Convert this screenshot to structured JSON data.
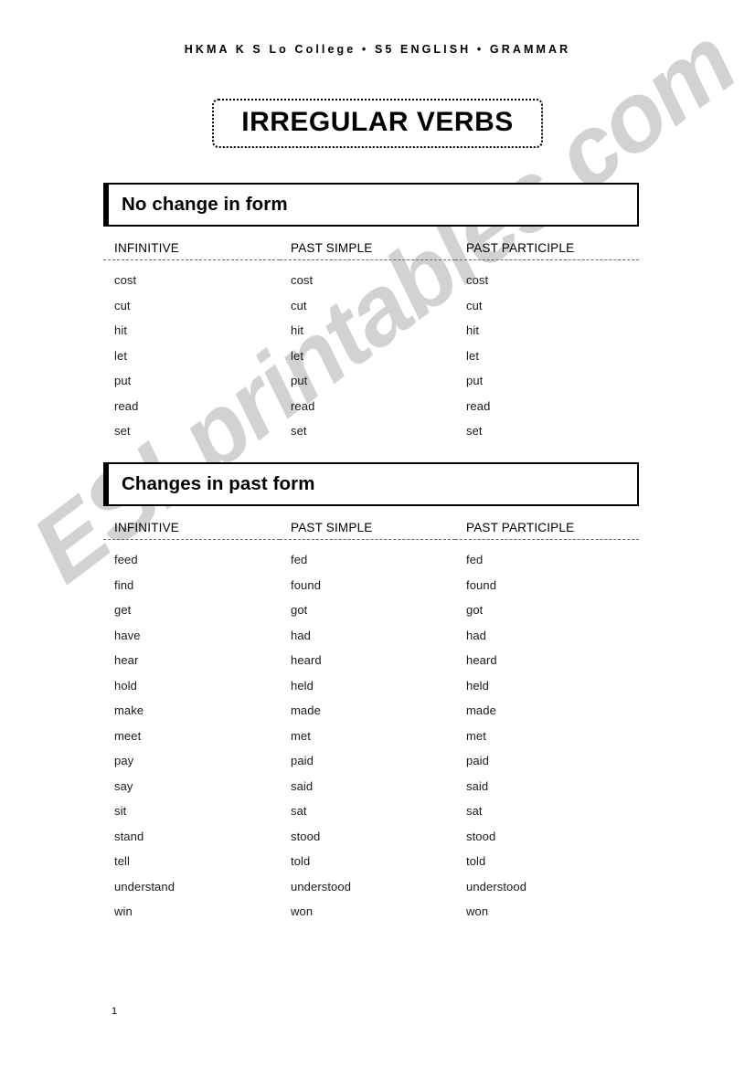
{
  "document": {
    "header": "HKMA  K  S  Lo  College   •   S5  ENGLISH   •   GRAMMAR",
    "title": "IRREGULAR VERBS",
    "page_number": "1",
    "watermark": "ESLprintables.com",
    "watermark_color": "#d2d2d2"
  },
  "columns": {
    "infinitive": "INFINITIVE",
    "past_simple": "PAST SIMPLE",
    "past_participle": "PAST PARTICIPLE"
  },
  "sections": [
    {
      "heading": "No change in form",
      "rows": [
        {
          "infinitive": "cost",
          "past_simple": "cost",
          "past_participle": "cost"
        },
        {
          "infinitive": "cut",
          "past_simple": "cut",
          "past_participle": "cut"
        },
        {
          "infinitive": "hit",
          "past_simple": "hit",
          "past_participle": "hit"
        },
        {
          "infinitive": "let",
          "past_simple": "let",
          "past_participle": "let"
        },
        {
          "infinitive": "put",
          "past_simple": "put",
          "past_participle": "put"
        },
        {
          "infinitive": "read",
          "past_simple": "read",
          "past_participle": "read"
        },
        {
          "infinitive": "set",
          "past_simple": "set",
          "past_participle": "set"
        }
      ]
    },
    {
      "heading": "Changes in past form",
      "rows": [
        {
          "infinitive": "feed",
          "past_simple": "fed",
          "past_participle": "fed"
        },
        {
          "infinitive": "find",
          "past_simple": "found",
          "past_participle": "found"
        },
        {
          "infinitive": "get",
          "past_simple": "got",
          "past_participle": "got"
        },
        {
          "infinitive": "have",
          "past_simple": "had",
          "past_participle": "had"
        },
        {
          "infinitive": "hear",
          "past_simple": "heard",
          "past_participle": "heard"
        },
        {
          "infinitive": "hold",
          "past_simple": "held",
          "past_participle": "held"
        },
        {
          "infinitive": "make",
          "past_simple": "made",
          "past_participle": "made"
        },
        {
          "infinitive": "meet",
          "past_simple": "met",
          "past_participle": "met"
        },
        {
          "infinitive": "pay",
          "past_simple": "paid",
          "past_participle": "paid"
        },
        {
          "infinitive": "say",
          "past_simple": "said",
          "past_participle": "said"
        },
        {
          "infinitive": "sit",
          "past_simple": "sat",
          "past_participle": "sat"
        },
        {
          "infinitive": "stand",
          "past_simple": "stood",
          "past_participle": "stood"
        },
        {
          "infinitive": "tell",
          "past_simple": "told",
          "past_participle": "told"
        },
        {
          "infinitive": "understand",
          "past_simple": "understood",
          "past_participle": "understood"
        },
        {
          "infinitive": "win",
          "past_simple": "won",
          "past_participle": "won"
        }
      ]
    }
  ]
}
